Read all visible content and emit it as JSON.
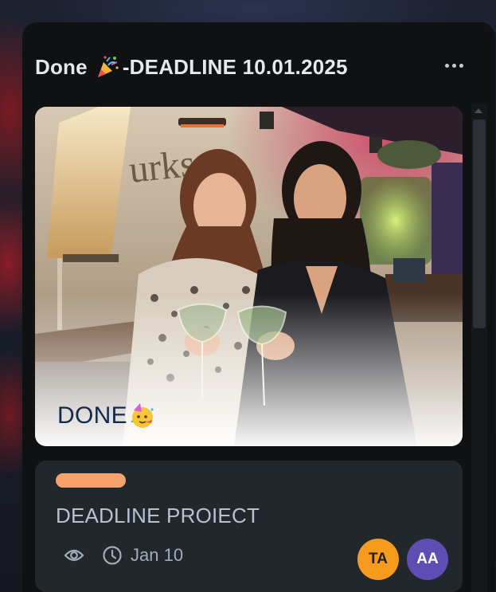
{
  "column": {
    "title_prefix": "Done",
    "title_icon": "party-popper-icon",
    "title_suffix": "-DEADLINE 10.01.2025",
    "menu_icon": "more-horizontal-icon"
  },
  "cover_card": {
    "text": "DONE",
    "text_icon": "partying-face-icon"
  },
  "task_card": {
    "label_color": "#f5a26c",
    "title": "DEADLINE PROIECT",
    "watch_icon": "eye-icon",
    "due_icon": "clock-icon",
    "due_date": "Jan 10",
    "members": [
      {
        "initials": "TA",
        "color": "#f79b1e",
        "text_color": "#1d2125"
      },
      {
        "initials": "AA",
        "color": "#5e4db2",
        "text_color": "#ffffff"
      }
    ]
  }
}
